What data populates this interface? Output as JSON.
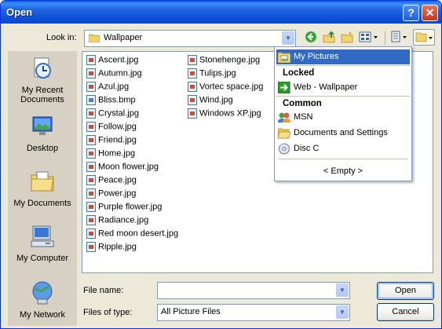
{
  "window": {
    "title": "Open",
    "help_glyph": "?",
    "close_glyph": "✕"
  },
  "lookin": {
    "label": "Look in:",
    "value": "Wallpaper"
  },
  "places": [
    "My Recent Documents",
    "Desktop",
    "My Documents",
    "My Computer",
    "My Network"
  ],
  "files_col1": [
    "Ascent.jpg",
    "Autumn.jpg",
    "Azul.jpg",
    "Bliss.bmp",
    "Crystal.jpg",
    "Follow.jpg",
    "Friend.jpg",
    "Home.jpg",
    "Moon flower.jpg",
    "Peace.jpg",
    "Power.jpg",
    "Purple flower.jpg",
    "Radiance.jpg",
    "Red moon desert.jpg",
    "Ripple.jpg"
  ],
  "files_col2": [
    "Stonehenge.jpg",
    "Tulips.jpg",
    "Vortec space.jpg",
    "Wind.jpg",
    "Windows XP.jpg"
  ],
  "filename": {
    "label": "File name:",
    "value": ""
  },
  "filetype": {
    "label": "Files of type:",
    "value": "All Picture Files"
  },
  "buttons": {
    "open": "Open",
    "cancel": "Cancel"
  },
  "menu": {
    "selected": "My Pictures",
    "locked_header": "Locked",
    "locked_items": [
      "Web - Wallpaper"
    ],
    "common_header": "Common",
    "common_items": [
      "MSN",
      "Documents and Settings",
      "Disc C"
    ],
    "empty": "< Empty >"
  },
  "colors": {
    "titlebar": "#0c4fd6",
    "selection": "#316ac5",
    "dialog_bg": "#ece9d8"
  }
}
